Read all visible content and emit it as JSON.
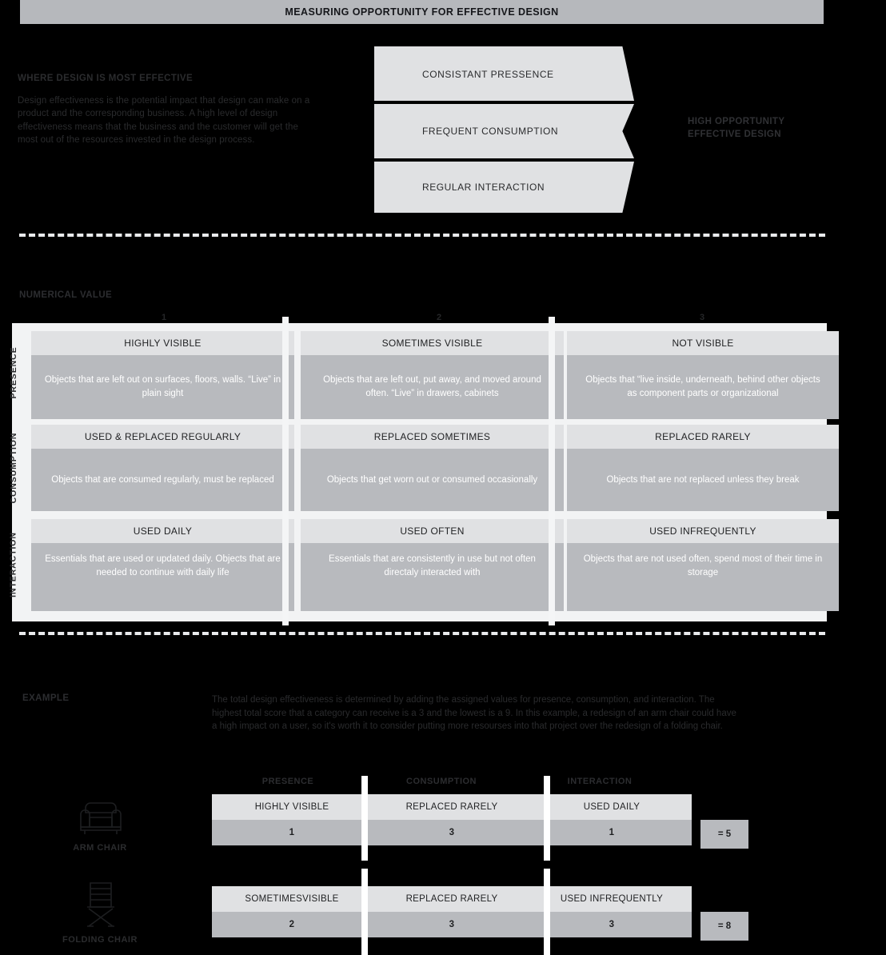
{
  "banner": {
    "title": "MEASURING OPPORTUNITY FOR EFFECTIVE DESIGN"
  },
  "intro": {
    "heading": "WHERE DESIGN IS MOST EFFECTIVE",
    "body": "Design effectiveness is the potential impact that design can make on a product and the corresponding business. A high level of design effectiveness means that the business and the customer will get the most out of the resources invested in the design process."
  },
  "funnel": {
    "bands": [
      {
        "label": "CONSISTANT PRESSENCE"
      },
      {
        "label": "FREQUENT CONSUMPTION"
      },
      {
        "label": "REGULAR INTERACTION"
      }
    ],
    "outcome_line_1": "HIGH OPPORTUNITY",
    "outcome_line_2": "EFFECTIVE DESIGN"
  },
  "matrix": {
    "axis_label": "NUMERICAL VALUE",
    "column_numbers": [
      "1",
      "2",
      "3"
    ],
    "row_labels": [
      "PRESENCE",
      "CONSUMPTION",
      "INTERACTION"
    ],
    "rows": [
      {
        "cells": [
          {
            "title": "HIGHLY VISIBLE",
            "desc": "Objects that are left out on surfaces, floors, walls. “Live” in plain sight"
          },
          {
            "title": "SOMETIMES VISIBLE",
            "desc": "Objects that are left out, put away, and moved around often. “Live” in drawers, cabinets"
          },
          {
            "title": "NOT VISIBLE",
            "desc": "Objects that “live inside, underneath, behind other objects as component parts or organizational"
          }
        ]
      },
      {
        "cells": [
          {
            "title": "USED & REPLACED REGULARLY",
            "desc": "Objects that are consumed regularly, must be replaced"
          },
          {
            "title": "REPLACED SOMETIMES",
            "desc": "Objects that get worn out or consumed occasionally"
          },
          {
            "title": "REPLACED RARELY",
            "desc": "Objects that are not replaced unless they break"
          }
        ]
      },
      {
        "cells": [
          {
            "title": "USED DAILY",
            "desc": "Essentials that are used or updated daily. Objects that are needed to continue with daily life"
          },
          {
            "title": "USED OFTEN",
            "desc": "Essentials that are consistently in use but not often directaly interacted with"
          },
          {
            "title": "USED INFREQUENTLY",
            "desc": "Objects that are not used often, spend most of their time in storage"
          }
        ]
      }
    ]
  },
  "example": {
    "heading": "EXAMPLE",
    "body": "The total design effectiveness is determined by adding the assigned values for presence, consumption, and interaction. The highest total score that a category can receive is a 3 and the lowest is a 9. In this example, a redesign of an arm chair could have a high impact on a user, so it's worth it to consider putting more resourses into that project over the redesign of a folding chair.",
    "column_headers": [
      "PRESENCE",
      "CONSUMPTION",
      "INTERACTION"
    ],
    "rows": [
      {
        "icon": "arm-chair-icon",
        "caption": "ARM CHAIR",
        "titles": [
          "HIGHLY VISIBLE",
          "REPLACED RARELY",
          "USED DAILY"
        ],
        "values": [
          "1",
          "3",
          "1"
        ],
        "total": "= 5"
      },
      {
        "icon": "folding-chair-icon",
        "caption": "FOLDING CHAIR",
        "titles": [
          "SOMETIMESVISIBLE",
          "REPLACED RARELY",
          "USED INFREQUENTLY"
        ],
        "values": [
          "2",
          "3",
          "3"
        ],
        "total": "= 8"
      }
    ]
  },
  "colors": {
    "background": "#000000",
    "banner": "#b6b8bc",
    "cell_header": "#e0e1e3",
    "cell_body": "#b8babe",
    "divider": "#f2f3f4"
  }
}
